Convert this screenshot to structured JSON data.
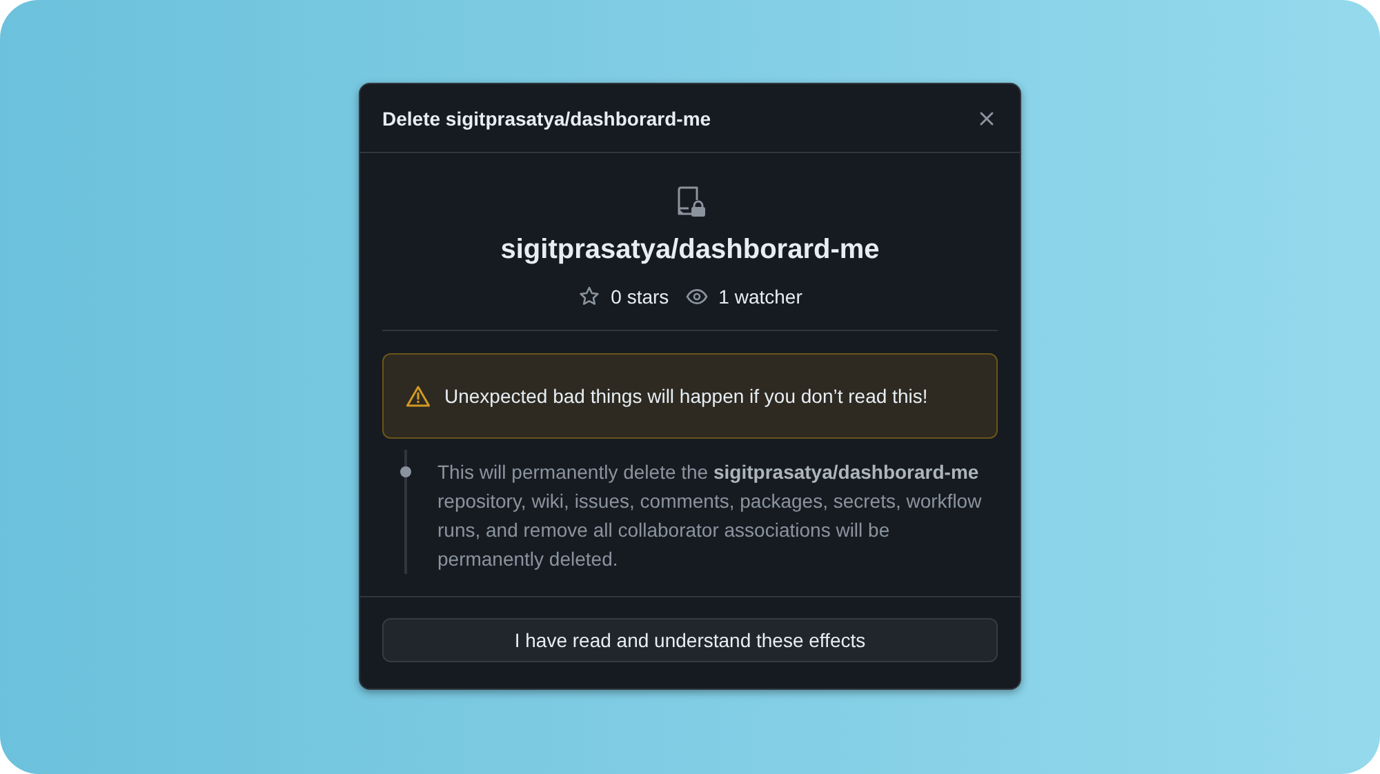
{
  "dialog": {
    "title": "Delete sigitprasatya/dashborard-me",
    "repo_name": "sigitprasatya/dashborard-me",
    "stats": [
      {
        "kind": "stars",
        "text": "0 stars"
      },
      {
        "kind": "watchers",
        "text": "1 watcher"
      }
    ],
    "warning": "Unexpected bad things will happen if you don’t read this!",
    "details": "This will permanently delete the **sigitprasatya/dashborard-me** repository, wiki, issues, comments, packages, secrets, workflow runs, and remove all collaborator associations will be permanently deleted.",
    "confirm_button": "I have read and understand these effects"
  }
}
